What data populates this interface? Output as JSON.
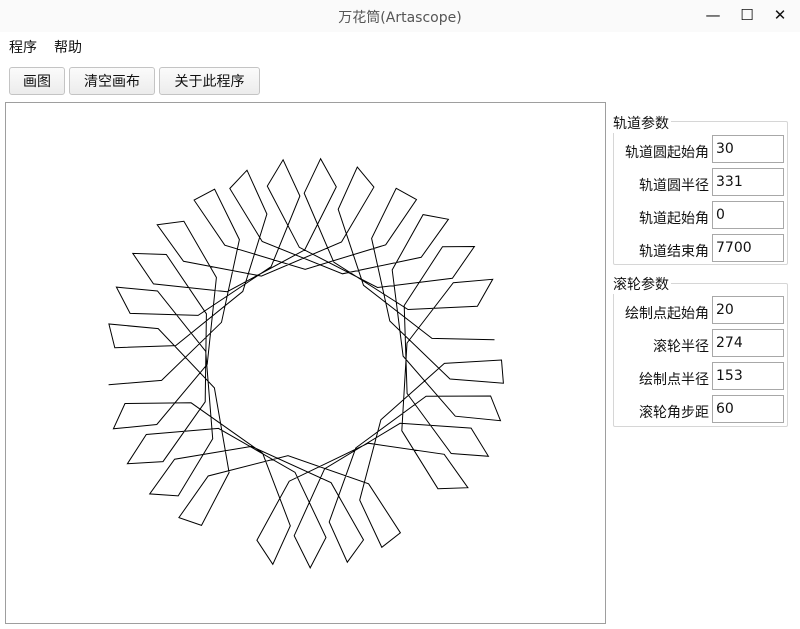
{
  "window": {
    "title": "万花筒(Artascope)",
    "controls": [
      "—",
      "☐",
      "✕"
    ]
  },
  "menu": {
    "items": [
      "程序",
      "帮助"
    ]
  },
  "toolbar": {
    "draw": "画图",
    "clear": "清空画布",
    "about": "关于此程序"
  },
  "orbit": {
    "title": "轨道参数",
    "fields": [
      {
        "label": "轨道圆起始角",
        "value": "30"
      },
      {
        "label": "轨道圆半径",
        "value": "331"
      },
      {
        "label": "轨道起始角",
        "value": "0"
      },
      {
        "label": "轨道结束角",
        "value": "7700"
      }
    ]
  },
  "wheel": {
    "title": "滚轮参数",
    "fields": [
      {
        "label": "绘制点起始角",
        "value": "20"
      },
      {
        "label": "滚轮半径",
        "value": "274"
      },
      {
        "label": "绘制点半径",
        "value": "153"
      },
      {
        "label": "滚轮角步距",
        "value": "60"
      }
    ]
  },
  "colors": {
    "stroke": "#000000",
    "accent": "#3c8ddc"
  }
}
